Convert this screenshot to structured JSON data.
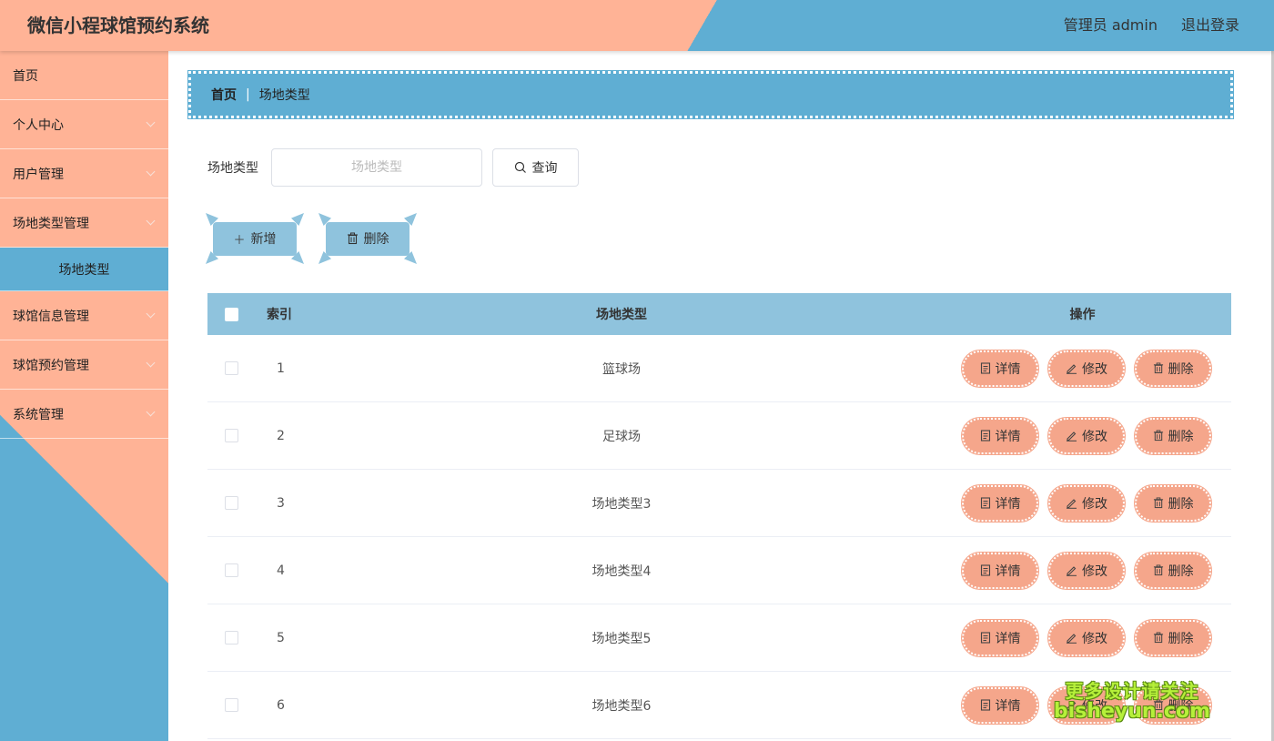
{
  "header": {
    "title": "微信小程球馆预约系统",
    "user": "管理员 admin",
    "logout": "退出登录"
  },
  "sidebar": {
    "items": [
      {
        "label": "首页",
        "has_children": false
      },
      {
        "label": "个人中心",
        "has_children": true
      },
      {
        "label": "用户管理",
        "has_children": true
      },
      {
        "label": "场地类型管理",
        "has_children": true
      },
      {
        "label": "场地类型",
        "sub": true
      },
      {
        "label": "球馆信息管理",
        "has_children": true
      },
      {
        "label": "球馆预约管理",
        "has_children": true
      },
      {
        "label": "系统管理",
        "has_children": true
      }
    ]
  },
  "breadcrumb": {
    "home": "首页",
    "sep": "|",
    "current": "场地类型"
  },
  "search": {
    "label": "场地类型",
    "placeholder": "场地类型",
    "button": "查询"
  },
  "actions": {
    "add": "新增",
    "delete": "删除"
  },
  "table": {
    "columns": {
      "index": "索引",
      "type": "场地类型",
      "ops": "操作"
    },
    "ops": {
      "detail": "详情",
      "edit": "修改",
      "delete": "删除"
    },
    "rows": [
      {
        "index": "1",
        "type": "篮球场"
      },
      {
        "index": "2",
        "type": "足球场"
      },
      {
        "index": "3",
        "type": "场地类型3"
      },
      {
        "index": "4",
        "type": "场地类型4"
      },
      {
        "index": "5",
        "type": "场地类型5"
      },
      {
        "index": "6",
        "type": "场地类型6"
      }
    ]
  },
  "watermark": {
    "line1": "更多设计请关注",
    "line2": "bisheyun.com"
  },
  "colors": {
    "salmon": "#ffb396",
    "blue": "#5faed3",
    "light_blue": "#8fc3dd",
    "op_salmon": "#f5a68b"
  }
}
